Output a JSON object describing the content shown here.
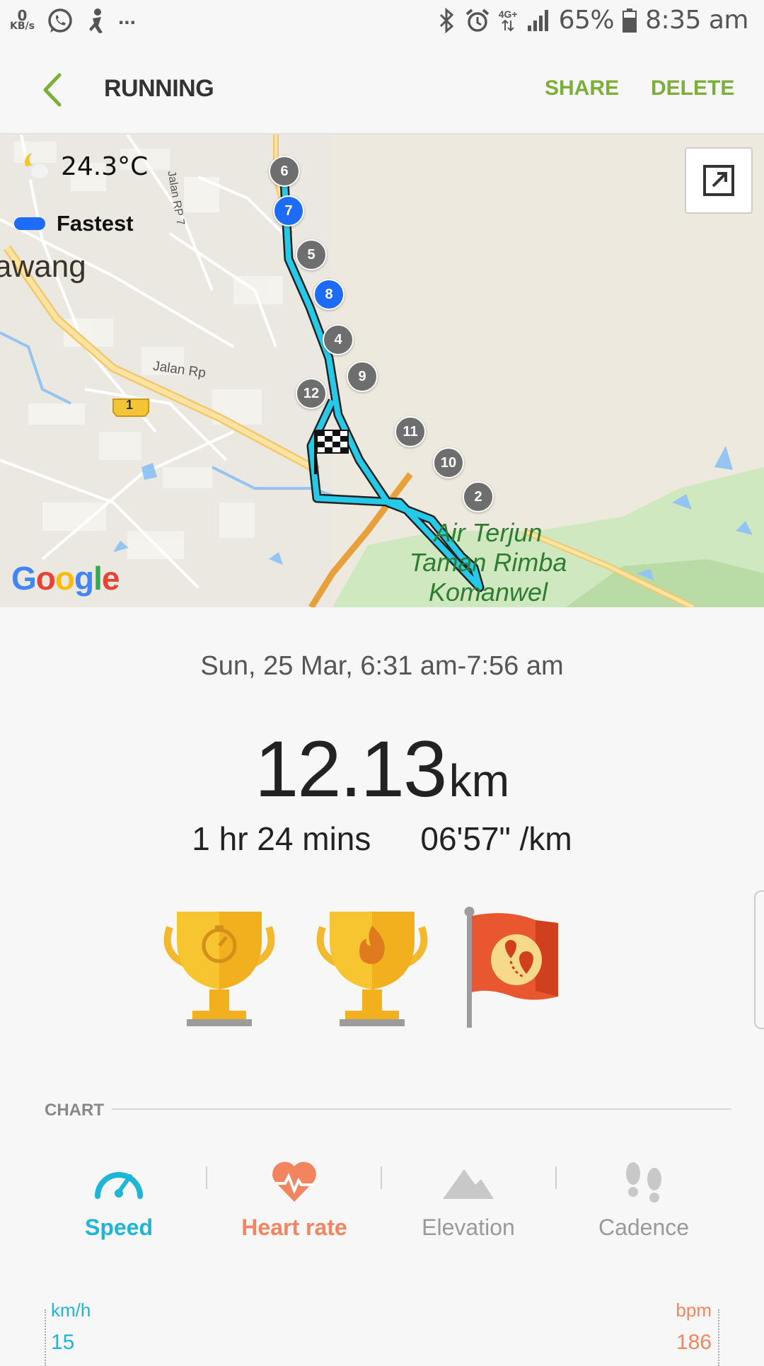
{
  "status": {
    "kbs_value": "0",
    "kbs_unit": "KB/s",
    "more": "...",
    "network": "4G+",
    "battery": "65%",
    "time": "8:35 am"
  },
  "appbar": {
    "title": "RUNNING",
    "share": "SHARE",
    "delete": "DELETE"
  },
  "map": {
    "temperature": "24.3°C",
    "legend_label": "Fastest",
    "place_label": "awang",
    "road_labels": [
      "Jalan RP 7",
      "Jalan Rp"
    ],
    "route_shield": "1",
    "poi_label": "Air Terjun Taman Rimba Komanwel",
    "brand": "Google",
    "markers": [
      "6",
      "7",
      "5",
      "8",
      "4",
      "9",
      "12",
      "11",
      "10",
      "2"
    ]
  },
  "summary": {
    "date_range": "Sun, 25 Mar, 6:31 am-7:56 am",
    "distance": "12.13",
    "distance_unit": "km",
    "duration": "1 hr 24 mins",
    "pace": "06'57\" /km"
  },
  "chart": {
    "header": "CHART",
    "tabs": [
      {
        "label": "Speed",
        "icon": "speedometer-icon",
        "color": "#1fb5d6"
      },
      {
        "label": "Heart rate",
        "icon": "heart-rate-icon",
        "color": "#f2855f"
      },
      {
        "label": "Elevation",
        "icon": "mountain-icon",
        "color": "#9a9a9a"
      },
      {
        "label": "Cadence",
        "icon": "footprints-icon",
        "color": "#9a9a9a"
      }
    ],
    "left_unit": "km/h",
    "left_value": "15",
    "right_unit": "bpm",
    "right_value": "186"
  },
  "colors": {
    "accent": "#7cae3a",
    "route": "#26c9e8",
    "fastest": "#1e6cf5"
  }
}
